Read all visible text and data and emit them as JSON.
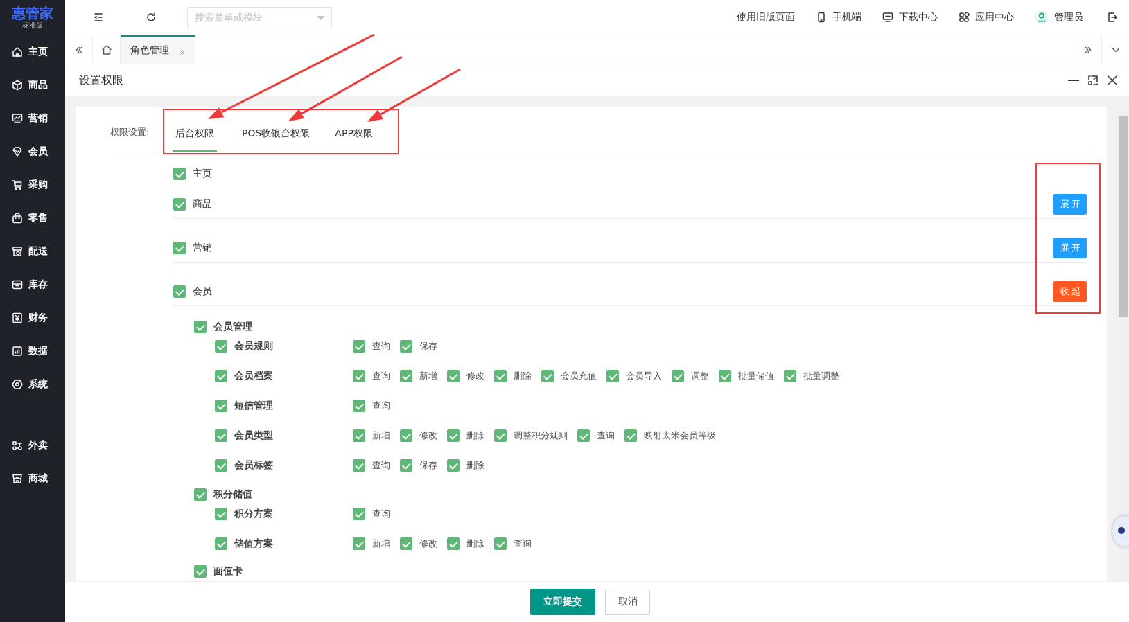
{
  "logo": {
    "name": "惠管家",
    "edition": "标准版"
  },
  "sidebar": {
    "groups": [
      [
        {
          "label": "主页"
        },
        {
          "label": "商品"
        },
        {
          "label": "营销"
        },
        {
          "label": "会员"
        },
        {
          "label": "采购"
        },
        {
          "label": "零售"
        },
        {
          "label": "配送"
        },
        {
          "label": "库存"
        },
        {
          "label": "财务"
        },
        {
          "label": "数据"
        },
        {
          "label": "系统"
        }
      ],
      [
        {
          "label": "外卖"
        },
        {
          "label": "商城"
        }
      ]
    ]
  },
  "topbar": {
    "search": {
      "placeholder": "搜索菜单或模块"
    },
    "links": [
      "使用旧版页面",
      "手机端",
      "下载中心",
      "应用中心",
      "管理员"
    ]
  },
  "page_tabs": [
    {
      "label": "角色管理",
      "selected": true
    }
  ],
  "dialog": {
    "title": "设置权限",
    "permission_label": "权限设置:",
    "permission_tabs": [
      {
        "label": "后台权限",
        "selected": true
      },
      {
        "label": "POS收银台权限",
        "selected": false
      },
      {
        "label": "APP权限",
        "selected": false
      }
    ],
    "modules": [
      {
        "label": "主页",
        "checked": true
      },
      {
        "label": "商品",
        "checked": true,
        "toggle": {
          "label": "展开",
          "kind": "expand"
        }
      },
      {
        "label": "营销",
        "checked": true,
        "toggle": {
          "label": "展开",
          "kind": "expand"
        }
      },
      {
        "label": "会员",
        "checked": true,
        "toggle": {
          "label": "收起",
          "kind": "collapse"
        },
        "children": [
          {
            "label": "会员管理",
            "checked": true,
            "children": [
              {
                "label": "会员规则",
                "checked": true,
                "actions": [
                  {
                    "label": "查询",
                    "checked": true
                  },
                  {
                    "label": "保存",
                    "checked": true
                  }
                ]
              },
              {
                "label": "会员档案",
                "checked": true,
                "actions": [
                  {
                    "label": "查询",
                    "checked": true
                  },
                  {
                    "label": "新增",
                    "checked": true
                  },
                  {
                    "label": "修改",
                    "checked": true
                  },
                  {
                    "label": "删除",
                    "checked": true
                  },
                  {
                    "label": "会员充值",
                    "checked": true
                  },
                  {
                    "label": "会员导入",
                    "checked": true
                  },
                  {
                    "label": "调整",
                    "checked": true
                  },
                  {
                    "label": "批量储值",
                    "checked": true
                  },
                  {
                    "label": "批量调整",
                    "checked": true
                  }
                ]
              },
              {
                "label": "短信管理",
                "checked": true,
                "actions": [
                  {
                    "label": "查询",
                    "checked": true
                  }
                ]
              },
              {
                "label": "会员类型",
                "checked": true,
                "actions": [
                  {
                    "label": "新增",
                    "checked": true
                  },
                  {
                    "label": "修改",
                    "checked": true
                  },
                  {
                    "label": "删除",
                    "checked": true
                  },
                  {
                    "label": "调整积分规则",
                    "checked": true
                  },
                  {
                    "label": "查询",
                    "checked": true
                  },
                  {
                    "label": "映射太米会员等级",
                    "checked": true
                  }
                ]
              },
              {
                "label": "会员标签",
                "checked": true,
                "actions": [
                  {
                    "label": "查询",
                    "checked": true
                  },
                  {
                    "label": "保存",
                    "checked": true
                  },
                  {
                    "label": "删除",
                    "checked": true
                  }
                ]
              }
            ]
          },
          {
            "label": "积分储值",
            "checked": true,
            "children": [
              {
                "label": "积分方案",
                "checked": true,
                "actions": [
                  {
                    "label": "查询",
                    "checked": true
                  }
                ]
              },
              {
                "label": "储值方案",
                "checked": true,
                "actions": [
                  {
                    "label": "新增",
                    "checked": true
                  },
                  {
                    "label": "修改",
                    "checked": true
                  },
                  {
                    "label": "删除",
                    "checked": true
                  },
                  {
                    "label": "查询",
                    "checked": true
                  }
                ]
              }
            ]
          },
          {
            "label": "面值卡",
            "checked": true
          }
        ]
      }
    ],
    "buttons": {
      "submit": "立即提交",
      "cancel": "取消"
    }
  }
}
